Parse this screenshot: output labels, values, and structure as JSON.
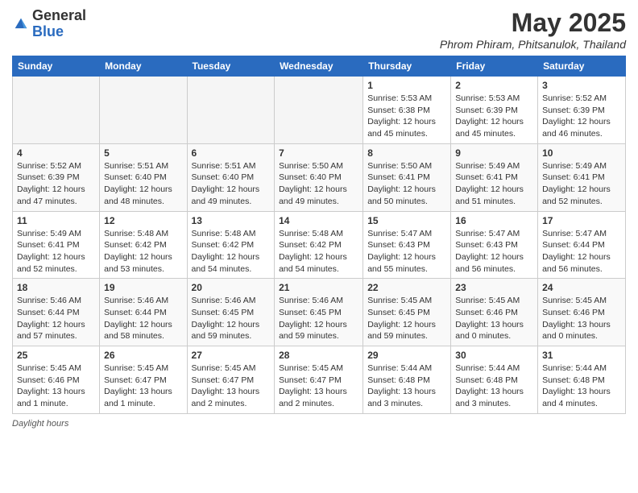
{
  "header": {
    "logo_general": "General",
    "logo_blue": "Blue",
    "month_title": "May 2025",
    "subtitle": "Phrom Phiram, Phitsanulok, Thailand"
  },
  "weekdays": [
    "Sunday",
    "Monday",
    "Tuesday",
    "Wednesday",
    "Thursday",
    "Friday",
    "Saturday"
  ],
  "footer": {
    "daylight_label": "Daylight hours"
  },
  "weeks": [
    [
      {
        "day": "",
        "empty": true
      },
      {
        "day": "",
        "empty": true
      },
      {
        "day": "",
        "empty": true
      },
      {
        "day": "",
        "empty": true
      },
      {
        "day": "1",
        "sunrise": "5:53 AM",
        "sunset": "6:38 PM",
        "daylight": "12 hours and 45 minutes."
      },
      {
        "day": "2",
        "sunrise": "5:53 AM",
        "sunset": "6:39 PM",
        "daylight": "12 hours and 45 minutes."
      },
      {
        "day": "3",
        "sunrise": "5:52 AM",
        "sunset": "6:39 PM",
        "daylight": "12 hours and 46 minutes."
      }
    ],
    [
      {
        "day": "4",
        "sunrise": "5:52 AM",
        "sunset": "6:39 PM",
        "daylight": "12 hours and 47 minutes."
      },
      {
        "day": "5",
        "sunrise": "5:51 AM",
        "sunset": "6:40 PM",
        "daylight": "12 hours and 48 minutes."
      },
      {
        "day": "6",
        "sunrise": "5:51 AM",
        "sunset": "6:40 PM",
        "daylight": "12 hours and 49 minutes."
      },
      {
        "day": "7",
        "sunrise": "5:50 AM",
        "sunset": "6:40 PM",
        "daylight": "12 hours and 49 minutes."
      },
      {
        "day": "8",
        "sunrise": "5:50 AM",
        "sunset": "6:41 PM",
        "daylight": "12 hours and 50 minutes."
      },
      {
        "day": "9",
        "sunrise": "5:49 AM",
        "sunset": "6:41 PM",
        "daylight": "12 hours and 51 minutes."
      },
      {
        "day": "10",
        "sunrise": "5:49 AM",
        "sunset": "6:41 PM",
        "daylight": "12 hours and 52 minutes."
      }
    ],
    [
      {
        "day": "11",
        "sunrise": "5:49 AM",
        "sunset": "6:41 PM",
        "daylight": "12 hours and 52 minutes."
      },
      {
        "day": "12",
        "sunrise": "5:48 AM",
        "sunset": "6:42 PM",
        "daylight": "12 hours and 53 minutes."
      },
      {
        "day": "13",
        "sunrise": "5:48 AM",
        "sunset": "6:42 PM",
        "daylight": "12 hours and 54 minutes."
      },
      {
        "day": "14",
        "sunrise": "5:48 AM",
        "sunset": "6:42 PM",
        "daylight": "12 hours and 54 minutes."
      },
      {
        "day": "15",
        "sunrise": "5:47 AM",
        "sunset": "6:43 PM",
        "daylight": "12 hours and 55 minutes."
      },
      {
        "day": "16",
        "sunrise": "5:47 AM",
        "sunset": "6:43 PM",
        "daylight": "12 hours and 56 minutes."
      },
      {
        "day": "17",
        "sunrise": "5:47 AM",
        "sunset": "6:44 PM",
        "daylight": "12 hours and 56 minutes."
      }
    ],
    [
      {
        "day": "18",
        "sunrise": "5:46 AM",
        "sunset": "6:44 PM",
        "daylight": "12 hours and 57 minutes."
      },
      {
        "day": "19",
        "sunrise": "5:46 AM",
        "sunset": "6:44 PM",
        "daylight": "12 hours and 58 minutes."
      },
      {
        "day": "20",
        "sunrise": "5:46 AM",
        "sunset": "6:45 PM",
        "daylight": "12 hours and 59 minutes."
      },
      {
        "day": "21",
        "sunrise": "5:46 AM",
        "sunset": "6:45 PM",
        "daylight": "12 hours and 59 minutes."
      },
      {
        "day": "22",
        "sunrise": "5:45 AM",
        "sunset": "6:45 PM",
        "daylight": "12 hours and 59 minutes."
      },
      {
        "day": "23",
        "sunrise": "5:45 AM",
        "sunset": "6:46 PM",
        "daylight": "13 hours and 0 minutes."
      },
      {
        "day": "24",
        "sunrise": "5:45 AM",
        "sunset": "6:46 PM",
        "daylight": "13 hours and 0 minutes."
      }
    ],
    [
      {
        "day": "25",
        "sunrise": "5:45 AM",
        "sunset": "6:46 PM",
        "daylight": "13 hours and 1 minute."
      },
      {
        "day": "26",
        "sunrise": "5:45 AM",
        "sunset": "6:47 PM",
        "daylight": "13 hours and 1 minute."
      },
      {
        "day": "27",
        "sunrise": "5:45 AM",
        "sunset": "6:47 PM",
        "daylight": "13 hours and 2 minutes."
      },
      {
        "day": "28",
        "sunrise": "5:45 AM",
        "sunset": "6:47 PM",
        "daylight": "13 hours and 2 minutes."
      },
      {
        "day": "29",
        "sunrise": "5:44 AM",
        "sunset": "6:48 PM",
        "daylight": "13 hours and 3 minutes."
      },
      {
        "day": "30",
        "sunrise": "5:44 AM",
        "sunset": "6:48 PM",
        "daylight": "13 hours and 3 minutes."
      },
      {
        "day": "31",
        "sunrise": "5:44 AM",
        "sunset": "6:48 PM",
        "daylight": "13 hours and 4 minutes."
      }
    ]
  ]
}
